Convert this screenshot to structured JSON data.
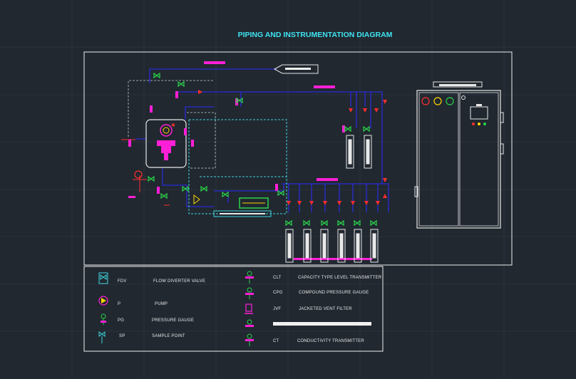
{
  "diagram": {
    "title": "PIPING AND INSTRUMENTATION DIAGRAM"
  },
  "legend": {
    "left": [
      {
        "code": "FDV",
        "description": "FLOW DIVERTER VALVE",
        "icon": "flow-diverter-valve-icon"
      },
      {
        "code": "P",
        "description": "PUMP",
        "icon": "pump-icon"
      },
      {
        "code": "PG",
        "description": "PRESSURE GAUGE",
        "icon": "pressure-gauge-icon"
      },
      {
        "code": "SP",
        "description": "SAMPLE POINT",
        "icon": "sample-point-icon"
      }
    ],
    "right": [
      {
        "code": "CLT",
        "description": "CAPACITY TYPE LEVEL TRANSMITTER",
        "icon": "level-transmitter-icon"
      },
      {
        "code": "CPG",
        "description": "COMPOUND PRESSURE GAUGE",
        "icon": "compound-pressure-gauge-icon"
      },
      {
        "code": "JVF",
        "description": "JACKETED VENT FILTER",
        "icon": "vent-filter-icon"
      },
      {
        "code": "",
        "description": "",
        "icon": "pipe-line-icon"
      },
      {
        "code": "CT",
        "description": "CONDUCTIVITY TRANSMITTER",
        "icon": "conductivity-transmitter-icon"
      }
    ]
  },
  "colors": {
    "background": "#212830",
    "title": "#3fe3f0",
    "pipe": "#2b2bd6",
    "valve": "#2ad24a",
    "tag": "#ff1fd6",
    "dashed": "#3fd5e0",
    "alarm": "#ff2e2e"
  }
}
